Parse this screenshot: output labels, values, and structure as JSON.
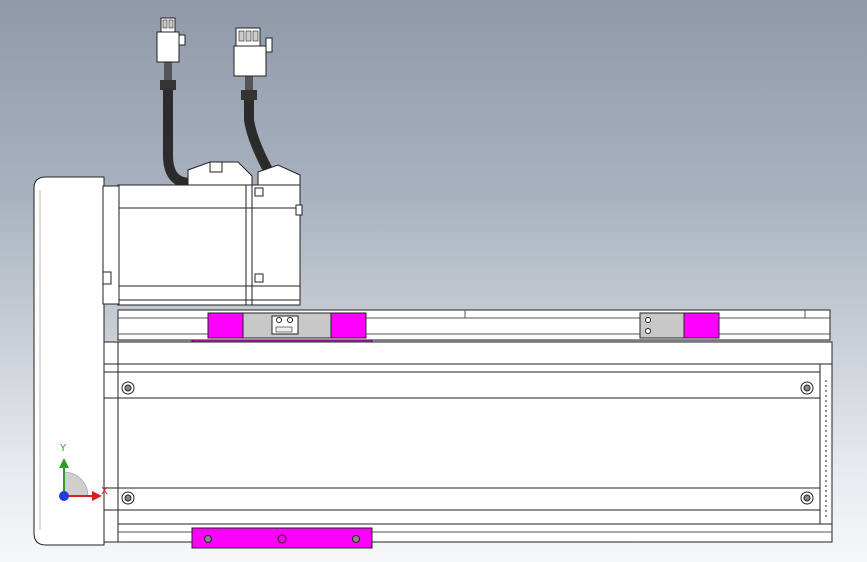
{
  "viewport": {
    "background_top": "#8f9aa9",
    "background_bottom": "#f6f7f8"
  },
  "model": {
    "component": "linear-actuator-with-servo-motor",
    "view": "front",
    "colors": {
      "body": "#ffffff",
      "edge": "#2a2a2a",
      "carriage_highlight": "#ff00ff",
      "cable": "#2b2b2b",
      "block_gray": "#c8c8c8"
    }
  },
  "triad": {
    "y_label": "Y",
    "x_label": "X",
    "y_color": "#2e9e2e",
    "x_color": "#d42020",
    "z_color": "#1f3fd6"
  }
}
